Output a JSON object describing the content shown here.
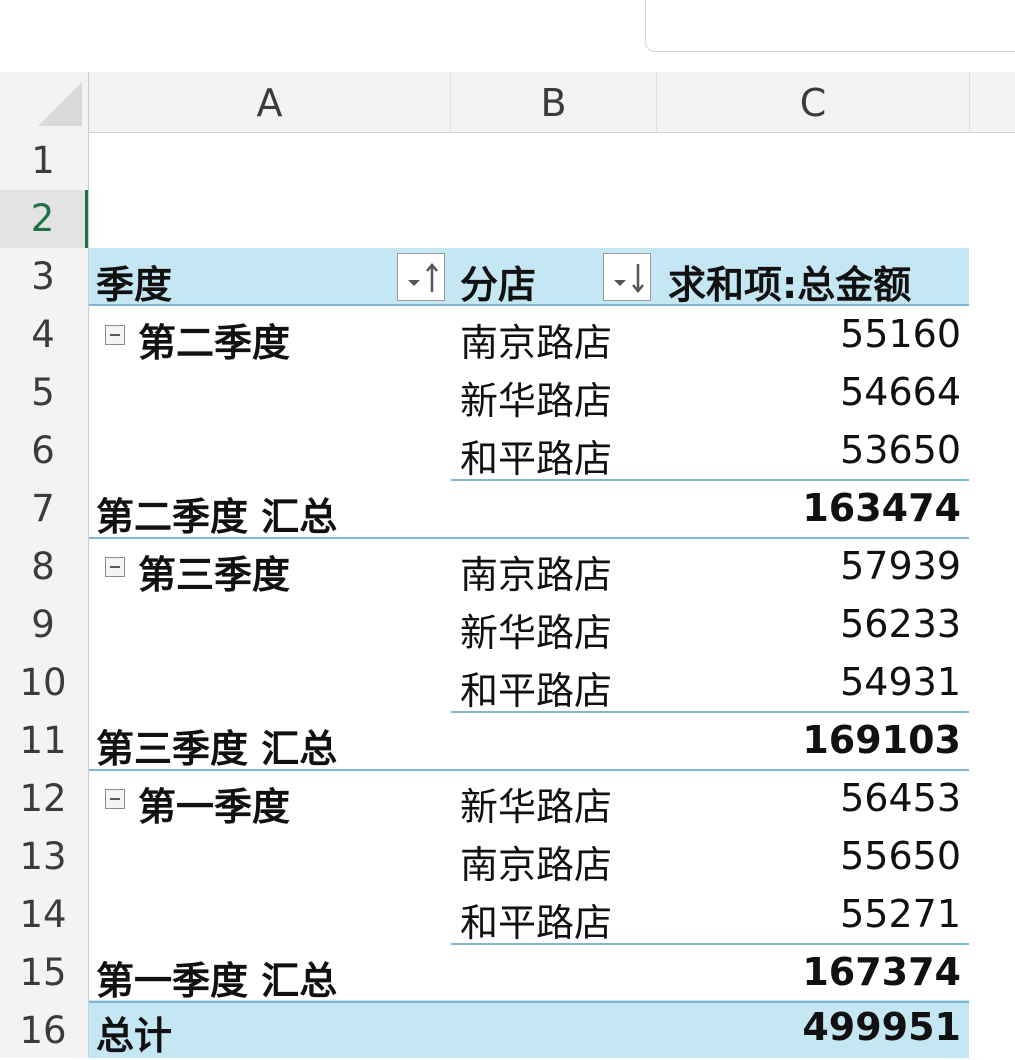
{
  "columns": [
    "A",
    "B",
    "C"
  ],
  "rows": [
    "1",
    "2",
    "3",
    "4",
    "5",
    "6",
    "7",
    "8",
    "9",
    "10",
    "11",
    "12",
    "13",
    "14",
    "15",
    "16"
  ],
  "pivot": {
    "header": {
      "quarter": "季度",
      "store": "分店",
      "sum": "求和项:总金额"
    },
    "groups": [
      {
        "name": "第二季度",
        "items": [
          {
            "store": "南京路店",
            "value": "55160"
          },
          {
            "store": "新华路店",
            "value": "54664"
          },
          {
            "store": "和平路店",
            "value": "53650"
          }
        ],
        "subtotal_label": "第二季度 汇总",
        "subtotal": "163474"
      },
      {
        "name": "第三季度",
        "items": [
          {
            "store": "南京路店",
            "value": "57939"
          },
          {
            "store": "新华路店",
            "value": "56233"
          },
          {
            "store": "和平路店",
            "value": "54931"
          }
        ],
        "subtotal_label": "第三季度 汇总",
        "subtotal": "169103"
      },
      {
        "name": "第一季度",
        "items": [
          {
            "store": "新华路店",
            "value": "56453"
          },
          {
            "store": "南京路店",
            "value": "55650"
          },
          {
            "store": "和平路店",
            "value": "55271"
          }
        ],
        "subtotal_label": "第一季度 汇总",
        "subtotal": "167374"
      }
    ],
    "grand_total_label": "总计",
    "grand_total": "499951"
  },
  "colors": {
    "accent_green": "#1e7145",
    "pivot_band": "#c5e6f3",
    "pivot_line": "#7fb7d4"
  },
  "icons": {
    "collapse": "minus-box-icon",
    "sort_asc": "sort-ascending-icon",
    "sort_desc": "sort-descending-icon"
  }
}
